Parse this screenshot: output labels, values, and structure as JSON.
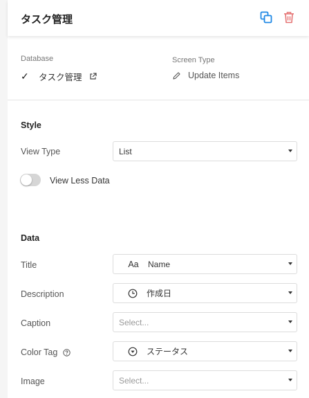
{
  "header": {
    "title": "タスク管理",
    "actions": [
      {
        "icon": "copy-icon",
        "color": "#1e88e5"
      },
      {
        "icon": "trash-icon",
        "color": "#e57373"
      }
    ]
  },
  "meta": {
    "database_label": "Database",
    "database_value": "タスク管理",
    "database_check": "✓",
    "screen_type_label": "Screen Type",
    "screen_type_value": "Update Items"
  },
  "style_section": {
    "title": "Style",
    "view_type_label": "View Type",
    "view_type_value": "List",
    "view_less_data_label": "View Less Data",
    "view_less_data_enabled": false
  },
  "data_section": {
    "title": "Data",
    "fields": [
      {
        "label": "Title",
        "icon": "text-format-icon",
        "icon_glyph": "Aa",
        "value": "Name",
        "placeholder": ""
      },
      {
        "label": "Description",
        "icon": "clock-icon",
        "icon_glyph": "",
        "value": "作成日",
        "placeholder": ""
      },
      {
        "label": "Caption",
        "icon": "",
        "icon_glyph": "",
        "value": "",
        "placeholder": "Select..."
      },
      {
        "label": "Color Tag",
        "icon": "dropdown-circle-icon",
        "icon_glyph": "",
        "value": "ステータス",
        "placeholder": ""
      },
      {
        "label": "Image",
        "icon": "",
        "icon_glyph": "",
        "value": "",
        "placeholder": "Select..."
      }
    ]
  }
}
